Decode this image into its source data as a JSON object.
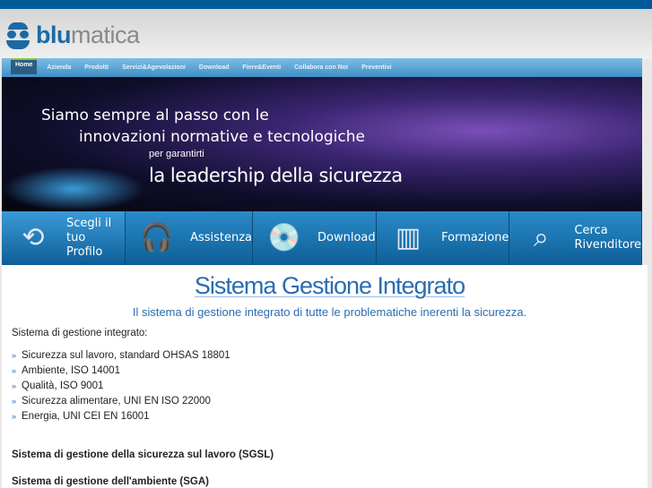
{
  "logo": {
    "part1": "blu",
    "part2": "matica"
  },
  "nav": [
    "Home",
    "Azienda",
    "Prodotti",
    "Servizi&Agevolazioni",
    "Download",
    "Fiere&Eventi",
    "Collabora con Noi",
    "Preventivi"
  ],
  "banner": {
    "line1": "Siamo sempre al passo con le",
    "line2": "innovazioni normative e tecnologiche",
    "line3": "per garantirti",
    "line4": "la leadership della sicurezza"
  },
  "quick": [
    {
      "label1": "Scegli il",
      "label2": "tuo Profilo",
      "icon": "profile-icon"
    },
    {
      "label1": "Assistenza",
      "label2": "",
      "icon": "headset-icon"
    },
    {
      "label1": "Download",
      "label2": "",
      "icon": "download-box-icon"
    },
    {
      "label1": "Formazione",
      "label2": "",
      "icon": "blackboard-icon"
    },
    {
      "label1": "Cerca",
      "label2": "Rivenditore",
      "icon": "search-map-icon"
    }
  ],
  "content": {
    "title": "Sistema Gestione Integrato",
    "subtitle": "Il sistema di gestione integrato di tutte le problematiche inerenti la sicurezza.",
    "intro": "Sistema di gestione integrato:",
    "items": [
      "Sicurezza sul lavoro, standard OHSAS 18801",
      "Ambiente, ISO 14001",
      "Qualità, ISO 9001",
      "Sicurezza alimentare, UNI EN ISO 22000",
      "Energia, UNI CEI EN 16001"
    ],
    "heading1": "Sistema di gestione della sicurezza sul lavoro (SGSL)",
    "heading2": "Sistema di gestione dell'ambiente (SGA)"
  }
}
